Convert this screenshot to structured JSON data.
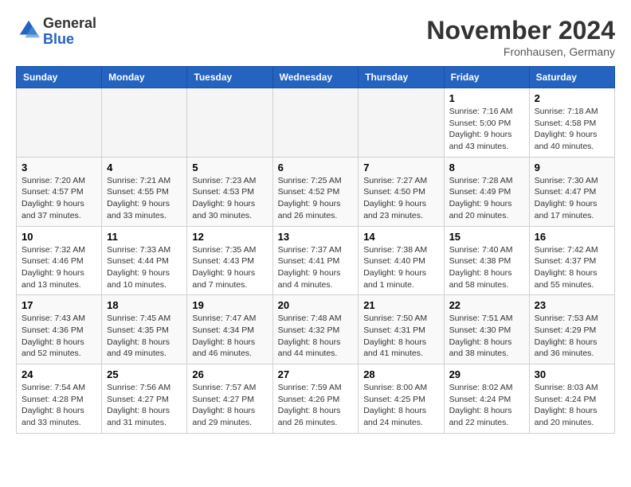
{
  "header": {
    "logo_general": "General",
    "logo_blue": "Blue",
    "month_year": "November 2024",
    "location": "Fronhausen, Germany"
  },
  "days_of_week": [
    "Sunday",
    "Monday",
    "Tuesday",
    "Wednesday",
    "Thursday",
    "Friday",
    "Saturday"
  ],
  "weeks": [
    [
      {
        "day": "",
        "info": ""
      },
      {
        "day": "",
        "info": ""
      },
      {
        "day": "",
        "info": ""
      },
      {
        "day": "",
        "info": ""
      },
      {
        "day": "",
        "info": ""
      },
      {
        "day": "1",
        "info": "Sunrise: 7:16 AM\nSunset: 5:00 PM\nDaylight: 9 hours and 43 minutes."
      },
      {
        "day": "2",
        "info": "Sunrise: 7:18 AM\nSunset: 4:58 PM\nDaylight: 9 hours and 40 minutes."
      }
    ],
    [
      {
        "day": "3",
        "info": "Sunrise: 7:20 AM\nSunset: 4:57 PM\nDaylight: 9 hours and 37 minutes."
      },
      {
        "day": "4",
        "info": "Sunrise: 7:21 AM\nSunset: 4:55 PM\nDaylight: 9 hours and 33 minutes."
      },
      {
        "day": "5",
        "info": "Sunrise: 7:23 AM\nSunset: 4:53 PM\nDaylight: 9 hours and 30 minutes."
      },
      {
        "day": "6",
        "info": "Sunrise: 7:25 AM\nSunset: 4:52 PM\nDaylight: 9 hours and 26 minutes."
      },
      {
        "day": "7",
        "info": "Sunrise: 7:27 AM\nSunset: 4:50 PM\nDaylight: 9 hours and 23 minutes."
      },
      {
        "day": "8",
        "info": "Sunrise: 7:28 AM\nSunset: 4:49 PM\nDaylight: 9 hours and 20 minutes."
      },
      {
        "day": "9",
        "info": "Sunrise: 7:30 AM\nSunset: 4:47 PM\nDaylight: 9 hours and 17 minutes."
      }
    ],
    [
      {
        "day": "10",
        "info": "Sunrise: 7:32 AM\nSunset: 4:46 PM\nDaylight: 9 hours and 13 minutes."
      },
      {
        "day": "11",
        "info": "Sunrise: 7:33 AM\nSunset: 4:44 PM\nDaylight: 9 hours and 10 minutes."
      },
      {
        "day": "12",
        "info": "Sunrise: 7:35 AM\nSunset: 4:43 PM\nDaylight: 9 hours and 7 minutes."
      },
      {
        "day": "13",
        "info": "Sunrise: 7:37 AM\nSunset: 4:41 PM\nDaylight: 9 hours and 4 minutes."
      },
      {
        "day": "14",
        "info": "Sunrise: 7:38 AM\nSunset: 4:40 PM\nDaylight: 9 hours and 1 minute."
      },
      {
        "day": "15",
        "info": "Sunrise: 7:40 AM\nSunset: 4:38 PM\nDaylight: 8 hours and 58 minutes."
      },
      {
        "day": "16",
        "info": "Sunrise: 7:42 AM\nSunset: 4:37 PM\nDaylight: 8 hours and 55 minutes."
      }
    ],
    [
      {
        "day": "17",
        "info": "Sunrise: 7:43 AM\nSunset: 4:36 PM\nDaylight: 8 hours and 52 minutes."
      },
      {
        "day": "18",
        "info": "Sunrise: 7:45 AM\nSunset: 4:35 PM\nDaylight: 8 hours and 49 minutes."
      },
      {
        "day": "19",
        "info": "Sunrise: 7:47 AM\nSunset: 4:34 PM\nDaylight: 8 hours and 46 minutes."
      },
      {
        "day": "20",
        "info": "Sunrise: 7:48 AM\nSunset: 4:32 PM\nDaylight: 8 hours and 44 minutes."
      },
      {
        "day": "21",
        "info": "Sunrise: 7:50 AM\nSunset: 4:31 PM\nDaylight: 8 hours and 41 minutes."
      },
      {
        "day": "22",
        "info": "Sunrise: 7:51 AM\nSunset: 4:30 PM\nDaylight: 8 hours and 38 minutes."
      },
      {
        "day": "23",
        "info": "Sunrise: 7:53 AM\nSunset: 4:29 PM\nDaylight: 8 hours and 36 minutes."
      }
    ],
    [
      {
        "day": "24",
        "info": "Sunrise: 7:54 AM\nSunset: 4:28 PM\nDaylight: 8 hours and 33 minutes."
      },
      {
        "day": "25",
        "info": "Sunrise: 7:56 AM\nSunset: 4:27 PM\nDaylight: 8 hours and 31 minutes."
      },
      {
        "day": "26",
        "info": "Sunrise: 7:57 AM\nSunset: 4:27 PM\nDaylight: 8 hours and 29 minutes."
      },
      {
        "day": "27",
        "info": "Sunrise: 7:59 AM\nSunset: 4:26 PM\nDaylight: 8 hours and 26 minutes."
      },
      {
        "day": "28",
        "info": "Sunrise: 8:00 AM\nSunset: 4:25 PM\nDaylight: 8 hours and 24 minutes."
      },
      {
        "day": "29",
        "info": "Sunrise: 8:02 AM\nSunset: 4:24 PM\nDaylight: 8 hours and 22 minutes."
      },
      {
        "day": "30",
        "info": "Sunrise: 8:03 AM\nSunset: 4:24 PM\nDaylight: 8 hours and 20 minutes."
      }
    ]
  ]
}
